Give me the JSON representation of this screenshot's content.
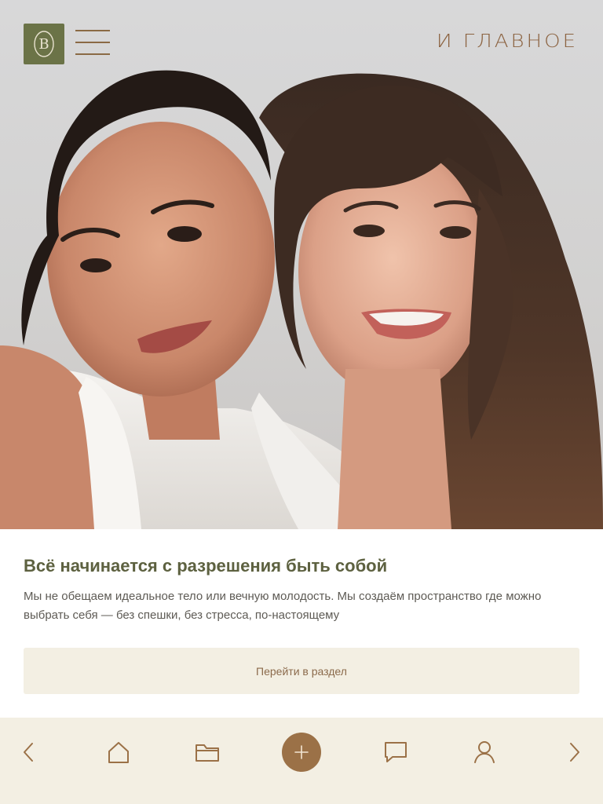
{
  "header": {
    "brand_wordmark": "И ГЛАВНОЕ",
    "logo_letter": "В"
  },
  "hero": {
    "image_alt": "Две улыбающиеся женщины в белых рубашках"
  },
  "main": {
    "headline": "Всё начинается с разрешения быть собой",
    "lead": "Мы не обещаем идеальное тело или вечную молодость. Мы создаём пространство где можно выбрать себя — без спешки, без стресса, по-настоящему",
    "cta_label": "Перейти в раздел"
  },
  "bottom_nav": {
    "items": [
      {
        "icon": "chevron-left-icon"
      },
      {
        "icon": "home-icon"
      },
      {
        "icon": "folder-icon"
      },
      {
        "icon": "plus-icon"
      },
      {
        "icon": "chat-icon"
      },
      {
        "icon": "user-icon"
      },
      {
        "icon": "chevron-right-icon"
      }
    ]
  },
  "colors": {
    "accent_olive": "#6b7347",
    "accent_brown": "#9b7147",
    "cream": "#f3efe3",
    "headline": "#5d6140"
  }
}
